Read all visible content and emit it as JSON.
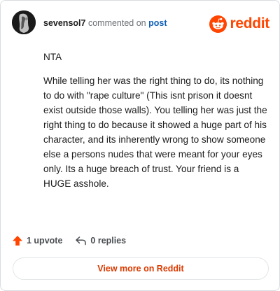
{
  "header": {
    "username": "sevensol7",
    "action_text": "commented on",
    "post_link_label": "post",
    "brand_name": "reddit"
  },
  "comment": {
    "paragraphs": [
      "NTA",
      "While telling her was the right thing to do, its nothing to do with \"rape culture\" (This isnt prison it doesnt exist outside those walls). You telling her was just the right thing to do because it showed a huge part of his character, and its inherently wrong to show someone else a persons nudes that were meant for your eyes only. Its a huge breach of trust. Your friend is a HUGE asshole."
    ]
  },
  "footer": {
    "upvotes_label": "1 upvote",
    "replies_label": "0 replies",
    "view_more_label": "View more on Reddit"
  },
  "icons": {
    "upvote": "arrow-up-icon",
    "reply": "reply-arrow-icon",
    "brand": "reddit-snoo-icon"
  },
  "colors": {
    "brand": "#ff4500",
    "link": "#0f5fb8",
    "cta_text": "#d93a00"
  }
}
